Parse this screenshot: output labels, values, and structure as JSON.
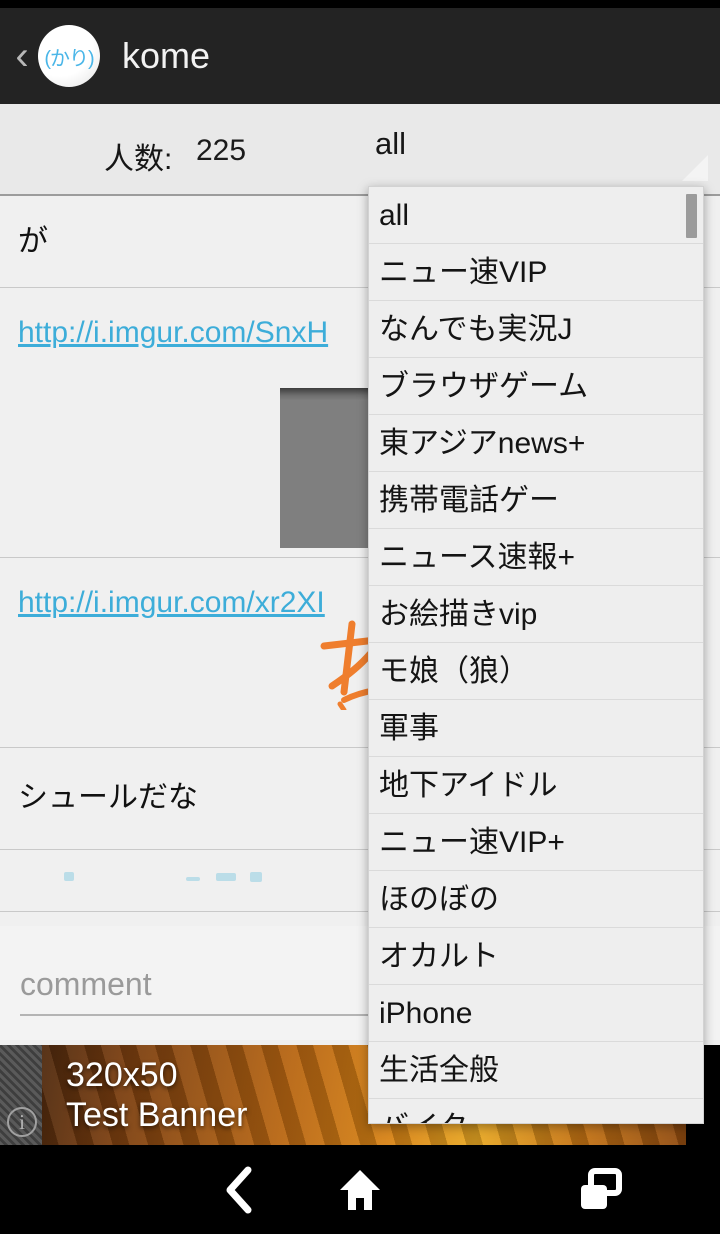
{
  "app": {
    "title": "kome",
    "icon_label": "(かり)",
    "icon_name": "app-avatar-kari",
    "back_glyph": "‹"
  },
  "info_bar": {
    "count_label": "人数:",
    "count_value": "225",
    "spinner_selected": "all"
  },
  "posts": [
    {
      "type": "text",
      "text": "が"
    },
    {
      "type": "link",
      "text": "http://i.imgur.com/SnxH"
    },
    {
      "type": "link",
      "text": "http://i.imgur.com/xr2XI"
    },
    {
      "type": "text",
      "text": "シュールだな"
    },
    {
      "type": "faint",
      "text": ""
    }
  ],
  "comment": {
    "placeholder": "comment",
    "value": ""
  },
  "ad": {
    "line1": "320x50",
    "line2": "Test Banner",
    "info_glyph": "i"
  },
  "dropdown": {
    "items": [
      "all",
      "ニュー速VIP",
      "なんでも実況J",
      "ブラウザゲーム",
      "東アジアnews+",
      "携帯電話ゲー",
      "ニュース速報+",
      "お絵描きvip",
      "モ娘（狼）",
      "軍事",
      "地下アイドル",
      "ニュー速VIP+",
      "ほのぼの",
      "オカルト",
      "iPhone",
      "生活全般",
      "バイク"
    ]
  },
  "nav": {
    "back": "back-icon",
    "home": "home-icon",
    "recents": "recents-icon"
  },
  "colors": {
    "action_bar": "#232323",
    "link": "#3dadd9",
    "accent_icon_text": "#4ab6e8",
    "doodle": "#ef7e2e"
  }
}
